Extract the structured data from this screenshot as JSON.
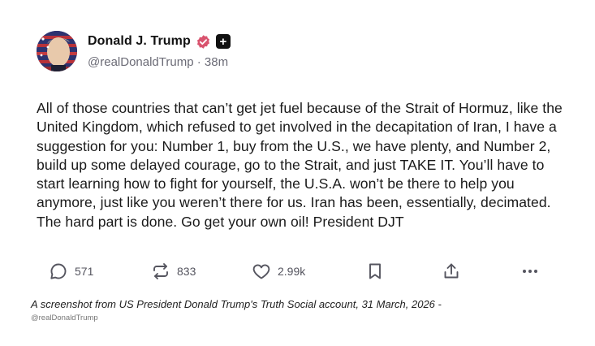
{
  "post": {
    "author": {
      "display_name": "Donald J. Trump",
      "handle": "@realDonaldTrump",
      "separator": " · ",
      "time": "38m",
      "verified_icon": "verified-badge-icon",
      "follow_icon": "plus-icon",
      "follow_label": "+"
    },
    "body": "All of those countries that can’t get jet fuel because of the Strait of Hormuz, like the United Kingdom, which refused to get involved in the decapitation of Iran, I have a suggestion for you: Number 1, buy from the U.S., we have plenty, and Number 2, build up some delayed courage, go to the Strait, and just TAKE IT. You’ll have to start learning how to fight for yourself, the U.S.A. won’t be there to help you anymore, just like you weren’t there for us. Iran has been, essentially, decimated. The hard part is done. Go get your own oil! President DJT",
    "actions": {
      "replies": "571",
      "retruths": "833",
      "likes": "2.99k"
    }
  },
  "caption": "A screenshot from US President Donald Trump's Truth Social account, 31 March, 2026",
  "caption_dash": " -",
  "credit": "@realDonaldTrump",
  "colors": {
    "verified_badge": "#d9536e",
    "muted_text": "#6b6b76",
    "icon_gray": "#55555f"
  }
}
